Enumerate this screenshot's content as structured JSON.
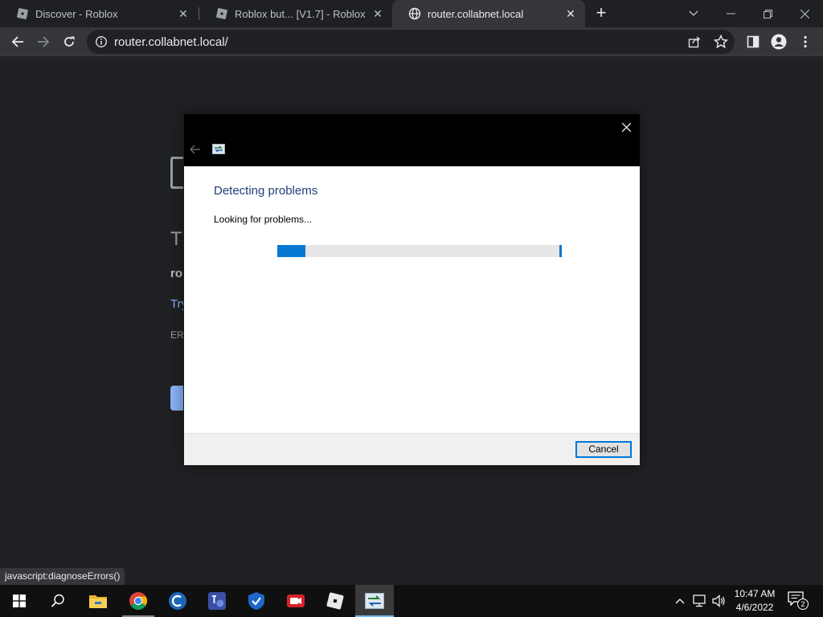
{
  "browser": {
    "tabs": [
      {
        "title": "Discover - Roblox",
        "favicon": "roblox-icon",
        "active": false
      },
      {
        "title": "Roblox but... [V1.7] - Roblox",
        "favicon": "roblox-icon",
        "active": false
      },
      {
        "title": "router.collabnet.local",
        "favicon": "globe-icon",
        "active": true
      }
    ],
    "url": "router.collabnet.local/",
    "status_text": "javascript:diagnoseErrors()"
  },
  "page": {
    "heading_fragment": "T",
    "bold_fragment": "ro",
    "link_fragment": "Try",
    "error_fragment": "ERI"
  },
  "dialog": {
    "title": "Detecting problems",
    "status": "Looking for problems...",
    "progress_fraction": 0.1,
    "cancel_label": "Cancel"
  },
  "taskbar": {
    "apps": [
      {
        "name": "file-explorer-icon",
        "running": false
      },
      {
        "name": "chrome-icon",
        "running": true
      },
      {
        "name": "ccleaner-icon",
        "running": false
      },
      {
        "name": "remote-desktop-icon",
        "running": false
      },
      {
        "name": "shield-vpn-icon",
        "running": false
      },
      {
        "name": "screen-recorder-icon",
        "running": false
      },
      {
        "name": "roblox-icon",
        "running": false
      },
      {
        "name": "network-diagnostics-icon",
        "running": true,
        "active": true
      }
    ],
    "time": "10:47 AM",
    "date": "4/6/2022",
    "notification_count": "2"
  },
  "colors": {
    "accent": "#0678d4",
    "dialog_title": "#1f3f7a",
    "browser_bg": "#202124",
    "taskbar_bg": "#101010"
  }
}
